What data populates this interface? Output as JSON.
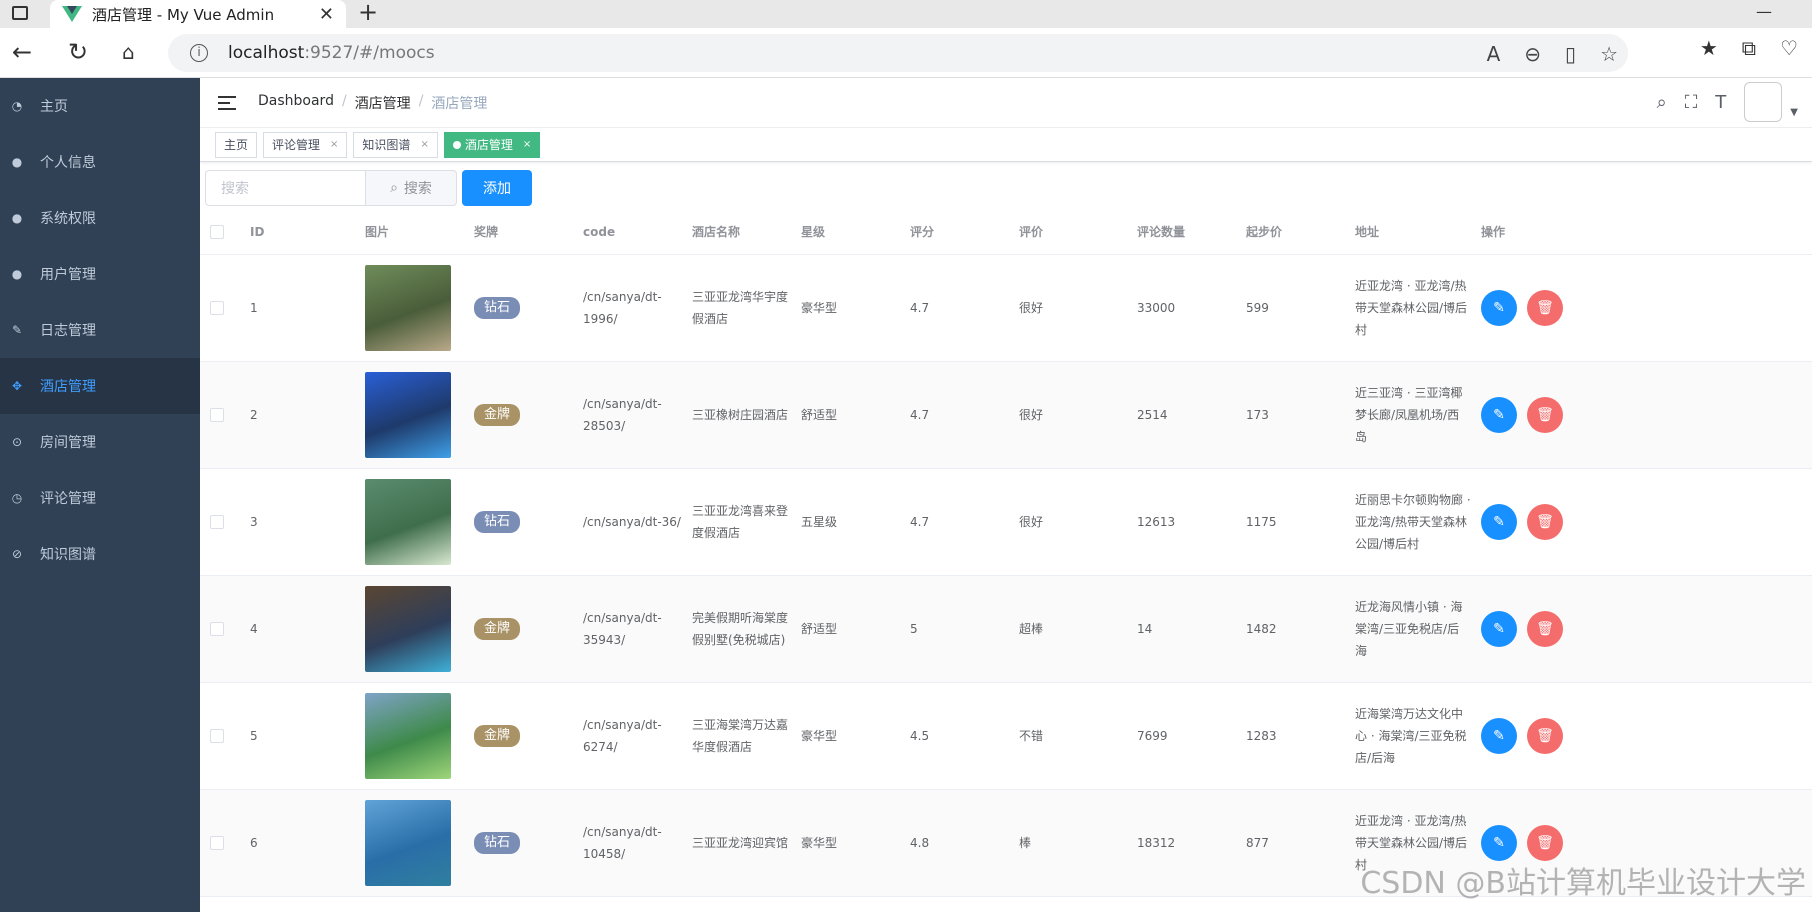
{
  "browser": {
    "tab_title": "酒店管理 - My Vue Admin",
    "url_host": "localhost",
    "url_path": ":9527/#/moocs"
  },
  "sidebar": {
    "items": [
      {
        "label": "主页",
        "icon": "dashboard-icon"
      },
      {
        "label": "个人信息",
        "icon": "user-icon"
      },
      {
        "label": "系统权限",
        "icon": "user-lock-icon"
      },
      {
        "label": "用户管理",
        "icon": "users-icon"
      },
      {
        "label": "日志管理",
        "icon": "feather-icon"
      },
      {
        "label": "酒店管理",
        "icon": "move-icon",
        "active": true
      },
      {
        "label": "房间管理",
        "icon": "location-icon"
      },
      {
        "label": "评论管理",
        "icon": "clock-icon"
      },
      {
        "label": "知识图谱",
        "icon": "compass-icon"
      }
    ]
  },
  "breadcrumb": [
    "Dashboard",
    "酒店管理",
    "酒店管理"
  ],
  "tags": [
    {
      "label": "主页",
      "closable": false,
      "active": false
    },
    {
      "label": "评论管理",
      "closable": true,
      "active": false
    },
    {
      "label": "知识图谱",
      "closable": true,
      "active": false
    },
    {
      "label": "酒店管理",
      "closable": true,
      "active": true
    }
  ],
  "toolbar": {
    "search_placeholder": "搜索",
    "search_button": "搜索",
    "add_button": "添加"
  },
  "table": {
    "columns": [
      "ID",
      "图片",
      "奖牌",
      "code",
      "酒店名称",
      "星级",
      "评分",
      "评价",
      "评论数量",
      "起步价",
      "地址",
      "操作"
    ],
    "rows": [
      {
        "id": "1",
        "medal": "钻石",
        "medal_color": "#7a8db5",
        "code": "/cn/sanya/dt-1996/",
        "name": "三亚亚龙湾华宇度假酒店",
        "star": "豪华型",
        "score": "4.7",
        "review": "很好",
        "count": "33000",
        "price": "599",
        "address": "近亚龙湾 · 亚龙湾/热带天堂森林公园/博后村",
        "img": [
          "#6f8c5a",
          "#4a5d3a",
          "#b9a98a"
        ]
      },
      {
        "id": "2",
        "medal": "金牌",
        "medal_color": "#a89266",
        "code": "/cn/sanya/dt-28503/",
        "name": "三亚橡树庄园酒店",
        "star": "舒适型",
        "score": "4.7",
        "review": "很好",
        "count": "2514",
        "price": "173",
        "address": "近三亚湾 · 三亚湾椰梦长廊/凤凰机场/西岛",
        "img": [
          "#2a5fd6",
          "#1e3a6b",
          "#3fa0e8"
        ]
      },
      {
        "id": "3",
        "medal": "钻石",
        "medal_color": "#7a8db5",
        "code": "/cn/sanya/dt-36/",
        "name": "三亚亚龙湾喜来登度假酒店",
        "star": "五星级",
        "score": "4.7",
        "review": "很好",
        "count": "12613",
        "price": "1175",
        "address": "近丽思卡尔顿购物廊 · 亚龙湾/热带天堂森林公园/博后村",
        "img": [
          "#5a8c6e",
          "#3f6e4c",
          "#d9e8d2"
        ]
      },
      {
        "id": "4",
        "medal": "金牌",
        "medal_color": "#a89266",
        "code": "/cn/sanya/dt-35943/",
        "name": "完美假期听海棠度假别墅(免税城店)",
        "star": "舒适型",
        "score": "5",
        "review": "超棒",
        "count": "14",
        "price": "1482",
        "address": "近龙海风情小镇 · 海棠湾/三亚免税店/后海",
        "img": [
          "#5a4632",
          "#2e3e5a",
          "#3fb0d8"
        ]
      },
      {
        "id": "5",
        "medal": "金牌",
        "medal_color": "#a89266",
        "code": "/cn/sanya/dt-6274/",
        "name": "三亚海棠湾万达嘉华度假酒店",
        "star": "豪华型",
        "score": "4.5",
        "review": "不错",
        "count": "7699",
        "price": "1283",
        "address": "近海棠湾万达文化中心 · 海棠湾/三亚免税店/后海",
        "img": [
          "#7fa3c7",
          "#3e8a4a",
          "#9fd67a"
        ]
      },
      {
        "id": "6",
        "medal": "钻石",
        "medal_color": "#7a8db5",
        "code": "/cn/sanya/dt-10458/",
        "name": "三亚亚龙湾迎宾馆",
        "star": "豪华型",
        "score": "4.8",
        "review": "棒",
        "count": "18312",
        "price": "877",
        "address": "近亚龙湾 · 亚龙湾/热带天堂森林公园/博后村",
        "img": [
          "#5fa3d8",
          "#2a6ea8",
          "#2f7f9f"
        ]
      }
    ]
  },
  "watermark": "CSDN @B站计算机毕业设计大学"
}
